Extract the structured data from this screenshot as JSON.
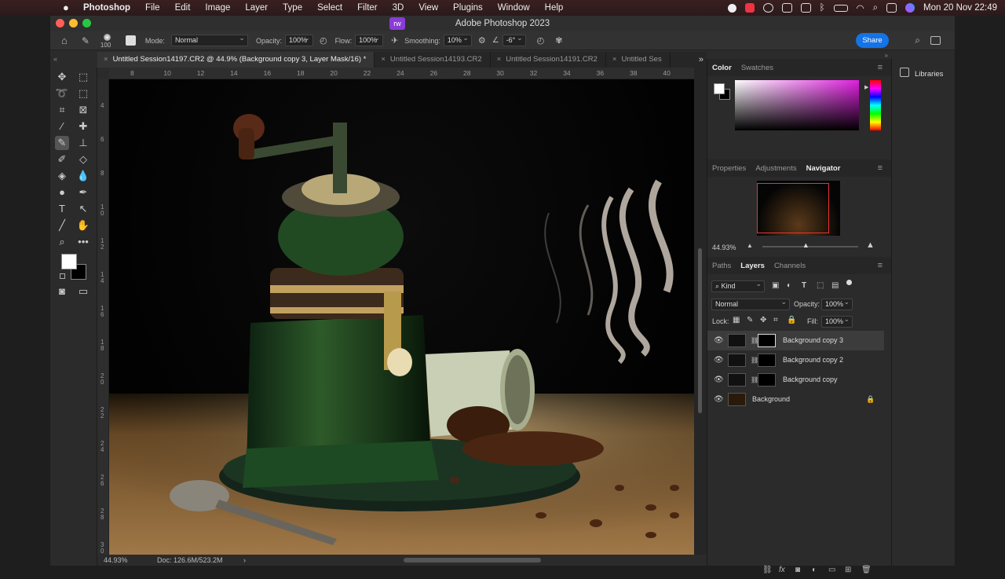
{
  "menubar": {
    "app_name": "Photoshop",
    "items": [
      "File",
      "Edit",
      "Image",
      "Layer",
      "Type",
      "Select",
      "Filter",
      "3D",
      "View",
      "Plugins",
      "Window",
      "Help"
    ],
    "date_time": "Mon 20 Nov  22:49"
  },
  "window": {
    "title": "Adobe Photoshop 2023",
    "badge": "rw"
  },
  "options": {
    "brush_size": "100",
    "mode_label": "Mode:",
    "mode_value": "Normal",
    "opacity_label": "Opacity:",
    "opacity_value": "100%",
    "flow_label": "Flow:",
    "flow_value": "100%",
    "smoothing_label": "Smoothing:",
    "smoothing_value": "10%",
    "angle_value": "-6°",
    "share_label": "Share"
  },
  "tabs": [
    {
      "label": "Untitled Session14197.CR2 @ 44.9% (Background copy 3, Layer Mask/16) *",
      "active": true
    },
    {
      "label": "Untitled Session14193.CR2",
      "active": false
    },
    {
      "label": "Untitled Session14191.CR2",
      "active": false
    },
    {
      "label": "Untitled Ses",
      "active": false
    }
  ],
  "ruler": {
    "top_ticks": [
      "8",
      "10",
      "12",
      "14",
      "16",
      "18",
      "20",
      "22",
      "24",
      "26",
      "28",
      "30",
      "32",
      "34",
      "36",
      "38",
      "40"
    ],
    "left_ticks": [
      "4",
      "6",
      "8",
      "1 0",
      "1 2",
      "1 4",
      "1 6",
      "1 8",
      "2 0",
      "2 2",
      "2 4",
      "2 6",
      "2 8",
      "3 0"
    ]
  },
  "status": {
    "zoom": "44.93%",
    "doc": "Doc: 126.6M/523.2M"
  },
  "color_panel": {
    "tabs": [
      "Color",
      "Swatches"
    ],
    "active": "Color"
  },
  "nav_panel": {
    "tabs": [
      "Properties",
      "Adjustments",
      "Navigator"
    ],
    "active": "Navigator",
    "zoom": "44.93%",
    "slider_level": 0.45
  },
  "layers_panel": {
    "tabs": [
      "Paths",
      "Layers",
      "Channels"
    ],
    "active": "Layers",
    "filter_label": "Kind",
    "blend_mode": "Normal",
    "opacity_label": "Opacity:",
    "opacity_value": "100%",
    "lock_label": "Lock:",
    "fill_label": "Fill:",
    "fill_value": "100%",
    "layers": [
      {
        "name": "Background copy 3",
        "selected": true
      },
      {
        "name": "Background copy 2",
        "selected": false
      },
      {
        "name": "Background copy",
        "selected": false
      },
      {
        "name": "Background",
        "selected": false
      }
    ]
  },
  "libraries": {
    "label": "Libraries"
  },
  "colors": {
    "accent": "#1473e6",
    "panel": "#2b2b2b",
    "fg_swatch": "#ffffff",
    "bg_swatch": "#000000"
  }
}
